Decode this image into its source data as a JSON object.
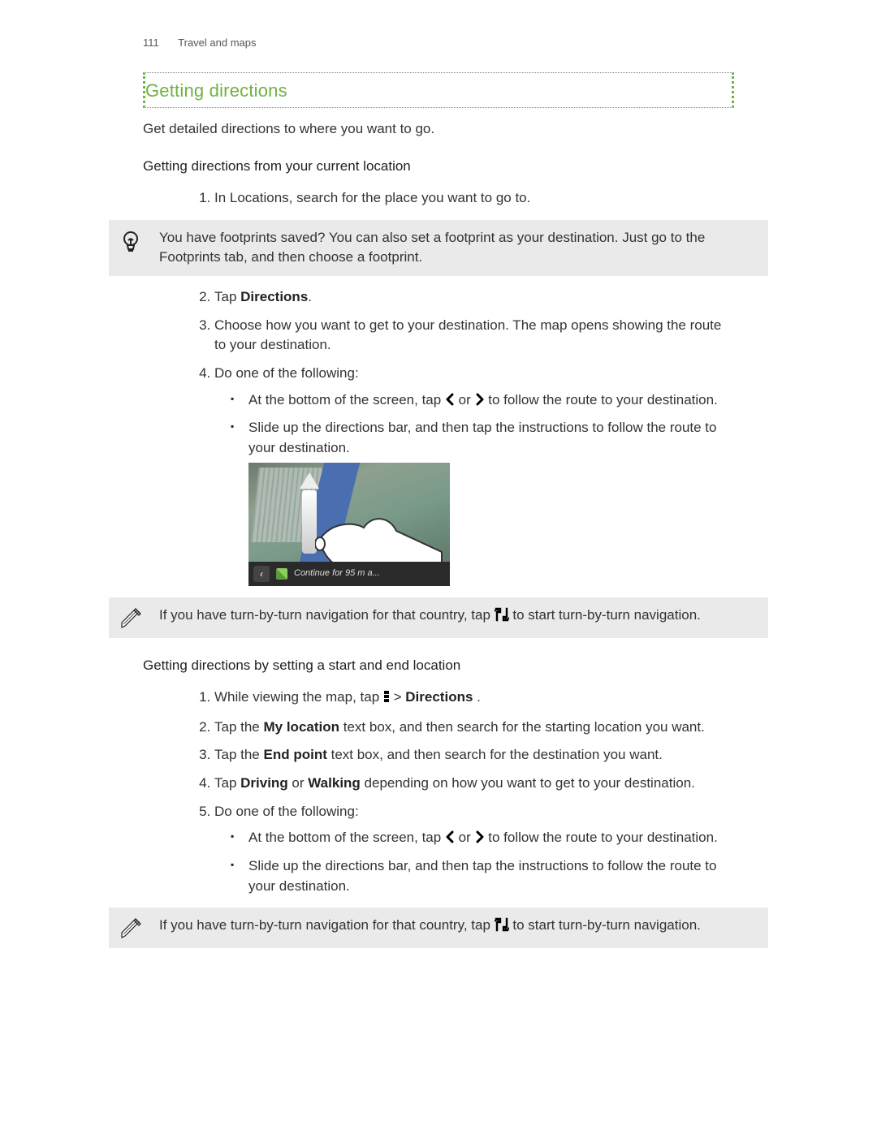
{
  "header": {
    "page_number": "111",
    "chapter": "Travel and maps"
  },
  "section_title": "Getting directions",
  "intro": "Get detailed directions to where you want to go.",
  "sub1": {
    "title": "Getting directions from your current location",
    "step1": "In Locations, search for the place you want to go to.",
    "tip": "You have footprints saved? You can also set a footprint as your destination. Just go to the Footprints tab, and then choose a footprint.",
    "step2_pre": "Tap ",
    "step2_bold": "Directions",
    "step2_post": ".",
    "step3": "Choose how you want to get to your destination. The map opens showing the route to your destination.",
    "step4": "Do one of the following:",
    "bullet1_pre": "At the bottom of the screen, tap ",
    "bullet1_mid": " or ",
    "bullet1_post": " to follow the route to your destination.",
    "bullet2": "Slide up the directions bar, and then tap the instructions to follow the route to your destination.",
    "illus_caption": "Continue for 95 m a...",
    "note_pre": "If you have turn-by-turn navigation for that country, tap ",
    "note_post": " to start turn-by-turn navigation."
  },
  "sub2": {
    "title": "Getting directions by setting a start and end location",
    "s1_pre": "While viewing the map, tap ",
    "s1_mid": " > ",
    "s1_bold": "Directions",
    "s1_post": " .",
    "s2_pre": "Tap the ",
    "s2_bold": "My location",
    "s2_post": " text box, and then search for the starting location you want.",
    "s3_pre": "Tap the ",
    "s3_bold": "End point",
    "s3_post": " text box, and then search for the destination you want.",
    "s4_pre": "Tap ",
    "s4_b1": "Driving",
    "s4_mid": " or ",
    "s4_b2": "Walking",
    "s4_post": " depending on how you want to get to your destination.",
    "s5": "Do one of the following:",
    "bullet1_pre": "At the bottom of the screen, tap ",
    "bullet1_mid": " or ",
    "bullet1_post": " to follow the route to your destination.",
    "bullet2": "Slide up the directions bar, and then tap the instructions to follow the route to your destination.",
    "note_pre": "If you have turn-by-turn navigation for that country, tap ",
    "note_post": " to start turn-by-turn navigation."
  }
}
